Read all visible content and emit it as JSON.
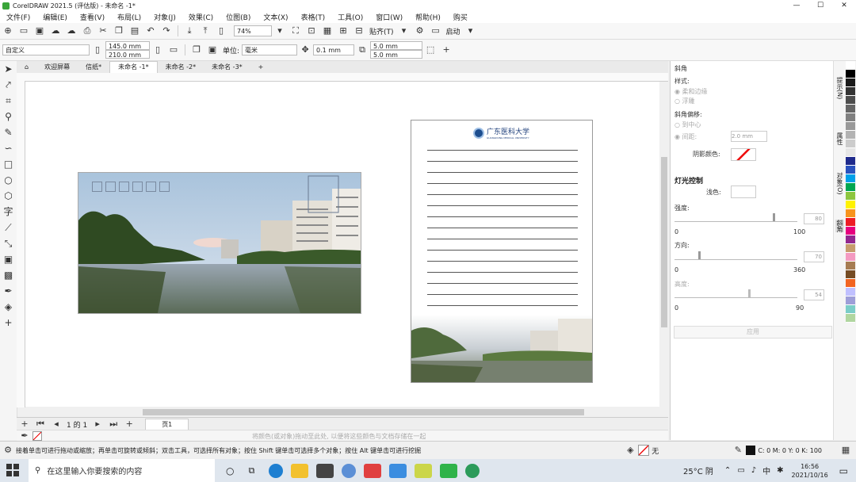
{
  "window": {
    "title": "CorelDRAW 2021.5 (评估版) - 未命名 -1*",
    "min": "—",
    "max": "☐",
    "close": "✕"
  },
  "menu": [
    "文件(F)",
    "编辑(E)",
    "查看(V)",
    "布局(L)",
    "对象(J)",
    "效果(C)",
    "位图(B)",
    "文本(X)",
    "表格(T)",
    "工具(O)",
    "窗口(W)",
    "帮助(H)",
    "购买"
  ],
  "toolbar1": {
    "zoom": "74%",
    "snap": "贴齐(T)",
    "launch": "启动"
  },
  "toolbar2": {
    "preset": "自定义",
    "width": "145.0 mm",
    "height": "210.0 mm",
    "units_label": "单位:",
    "units": "毫米",
    "nudge": "0.1 mm",
    "dup_x": "5.0 mm",
    "dup_y": "5.0 mm"
  },
  "tabs": [
    {
      "label": "欢迎屏幕"
    },
    {
      "label": "信纸*"
    },
    {
      "label": "未命名 -1*"
    },
    {
      "label": "未命名 -2*"
    },
    {
      "label": "未命名 -3*"
    }
  ],
  "letter": {
    "logo_text": "广东医科大学",
    "logo_sub": "GUANGDONG MEDICAL UNIVERSITY"
  },
  "pagenav": {
    "index": "1 的 1",
    "page": "页1"
  },
  "colorstrip": {
    "hint": "将颜色(或对象)拖动至此处, 以便将这些颜色与文档存储在一起"
  },
  "docker": {
    "title": "斜角",
    "style_label": "样式:",
    "style_opt1": "柔和边缘",
    "style_opt2": "浮雕",
    "offset_label": "斜角偏移:",
    "offset_opt1": "到中心",
    "offset_opt2": "间距:",
    "offset_value": "2.0 mm",
    "shadow_label": "阴影颜色:",
    "light_title": "灯光控制",
    "light_color_label": "浅色:",
    "intensity_label": "强度:",
    "intensity_value": "80",
    "intensity_min": "0",
    "intensity_max": "100",
    "direction_label": "方向:",
    "direction_value": "70",
    "direction_min": "0",
    "direction_max": "360",
    "altitude_label": "高度:",
    "altitude_value": "54",
    "altitude_min": "0",
    "altitude_max": "90",
    "apply": "应用"
  },
  "sidetabs": [
    "提示(N)",
    "属性",
    "对象(O)",
    "斜角"
  ],
  "palette": [
    "#ffffff",
    "#000000",
    "#1a1a1a",
    "#333333",
    "#4d4d4d",
    "#666666",
    "#808080",
    "#999999",
    "#b3b3b3",
    "#cccccc",
    "#e6e6e6",
    "#1f2a8c",
    "#2a52be",
    "#00a0e9",
    "#00a651",
    "#8dc63f",
    "#fff200",
    "#f7941d",
    "#ed1c24",
    "#e6007e",
    "#92278f",
    "#c69c6d",
    "#f49ac1",
    "#a67c52",
    "#754c24",
    "#f26522",
    "#c0c0ff",
    "#9e9ed8",
    "#7bcdc8",
    "#b0d6a0"
  ],
  "status": {
    "hint": "接着单击可进行拖动或缩放；再单击可旋转或倾斜；双击工具，可选择所有对象；按住 Shift 键单击可选择多个对象；按住 Alt 键单击可进行挖掘",
    "fill_none": "无",
    "color_readout": "C: 0 M: 0 Y: 0 K: 100"
  },
  "taskbar": {
    "search_placeholder": "在这里输入你要搜索的内容",
    "weather": "25°C 阴",
    "ime": "中",
    "time": "16:56",
    "date": "2021/10/16"
  }
}
